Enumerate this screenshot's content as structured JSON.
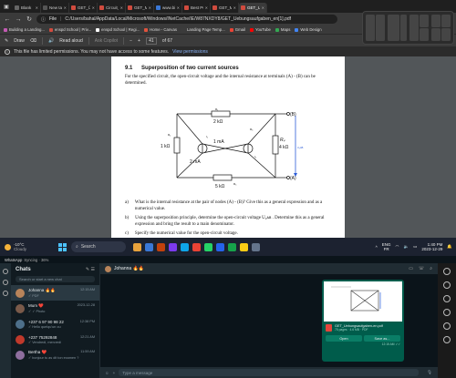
{
  "browser": {
    "tabs": [
      {
        "label": "Blank",
        "color": "#666666"
      },
      {
        "label": "New tab",
        "color": "#555555"
      },
      {
        "label": "GET_Üebi",
        "color": "#d14b3e"
      },
      {
        "label": "Circuit_A",
        "color": "#d14b3e"
      },
      {
        "label": "GET_Mus",
        "color": "#d14b3e"
      },
      {
        "label": "www.bim",
        "color": "#3a78d6"
      },
      {
        "label": "Best POF",
        "color": "#d14b3e"
      },
      {
        "label": "GET_Mus",
        "color": "#d14b3e"
      },
      {
        "label": "GET_Uebu",
        "color": "#d14b3e"
      }
    ],
    "address": {
      "scheme_label": "File",
      "url": "C:/Users/bahal/AppData/Local/Microsoft/Windows/INetCache/IE/W87NXDY8/GET_Uebungsaufgaben_en[1].pdf"
    },
    "bookmarks": [
      {
        "label": "Building a Landing...",
        "color": "#c45ab3"
      },
      {
        "label": "enspd School | Priv...",
        "color": "#d14b3e"
      },
      {
        "label": "enspd School | Regi...",
        "color": "#ffffff"
      },
      {
        "label": "Home - Canvas",
        "color": "#e0533d"
      },
      {
        "label": "Landing Page Temp...",
        "color": "#3b3b3b"
      },
      {
        "label": "Gmail",
        "color": "#ea4335"
      },
      {
        "label": "YouTube",
        "color": "#ff0000"
      },
      {
        "label": "Maps",
        "color": "#34a853"
      },
      {
        "label": "Web Design",
        "color": "#4285f4"
      }
    ]
  },
  "pdf_toolbar": {
    "draw": "Draw",
    "read_aloud": "Read aloud",
    "ask_copilot": "Ask Copilot",
    "page": "41",
    "of_pages": "of 67"
  },
  "notice": {
    "text": "This file has limited permissions. You may not have access to some features.",
    "link": "View permissions"
  },
  "document": {
    "section_number": "9.1",
    "section_title": "Superposition of two current sources",
    "intro": "For the specified circuit, the open-circuit voltage and the internal resistance at terminals (A) - (B) can be determined.",
    "circuit_labels": {
      "r_top": "2 kΩ",
      "r_left": "1 kΩ",
      "r_right_name": "R₄",
      "r_right": "4 kΩ",
      "r_bottom": "5 kΩ",
      "source1": "1 mA",
      "source2": "2 mA",
      "terminal_b": "(B)",
      "terminal_a": "(A)",
      "u_label": "U₀AB",
      "tag_r1": "R₁",
      "tag_r2": "R₂",
      "tag_r3": "R₃",
      "tag_r5": "R₅",
      "tag_i1": "I₁",
      "tag_i2": "I₂"
    },
    "questions": [
      {
        "letter": "a)",
        "text": "What is the internal resistance at the pair of nodes (A) - (B)? Give this as a general expression and as a numerical value."
      },
      {
        "letter": "b)",
        "text": "Using the superposition principle, determine the open-circuit voltage U₀ᴀʙ . Determine this as a general expression and bring the result to a main denominator."
      },
      {
        "letter": "c)",
        "text": "Specify the numerical value for the open-circuit voltage."
      }
    ]
  },
  "taskbar": {
    "weather_temp": "-10°C",
    "weather_desc": "Cloudy",
    "search_placeholder": "Search",
    "lang_top": "ENG",
    "lang_bottom": "FR",
    "time": "1:40 PM",
    "date": "2023-12-29"
  },
  "whatsapp": {
    "title": "WhatsApp",
    "title_sub": "Syncing · 36%",
    "chats_heading": "Chats",
    "search_placeholder": "Search or start a new chat",
    "chats": [
      {
        "name": "Johanna 🔥🔥",
        "time": "12:15 AM",
        "preview": "✓ PDF",
        "color": "#b9845a"
      },
      {
        "name": "Mum ❤️",
        "time": "2023-12-28",
        "preview": "✓ ✓ Photo",
        "color": "#7a5a4a"
      },
      {
        "name": "+237 6 97 90 98 22",
        "time": "12:38 PM",
        "preview": "✓ Hello quelqu'un ou",
        "color": "#4d6f8a"
      },
      {
        "name": "+237 75292848",
        "time": "12:21 AM",
        "preview": "✓ Vendredi, mercredi",
        "color": "#c0392b"
      },
      {
        "name": "Bertha ❤️",
        "time": "11:59 AM",
        "preview": "✓ bonjour tu as dit ton examen ?",
        "color": "#8e6e9e"
      }
    ],
    "conversation": {
      "contact": "Johanna 🔥🔥",
      "file_name": "GET_Uebungsaufgaben-en.pdf",
      "file_meta": "75 pages · 4.6 MB · PDF",
      "open_label": "Open",
      "save_label": "Save as...",
      "msg_time": "12:15 AM ✓✓",
      "composer_placeholder": "Type a message"
    }
  }
}
